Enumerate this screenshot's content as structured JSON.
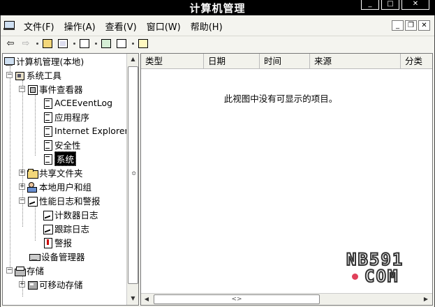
{
  "window": {
    "title": "计算机管理",
    "controls": {
      "minimize": "_",
      "maximize": "□",
      "close": "✕"
    }
  },
  "menubar": {
    "items": [
      "文件(F)",
      "操作(A)",
      "查看(V)",
      "窗口(W)",
      "帮助(H)"
    ],
    "mdi_controls": {
      "minimize": "_",
      "restore": "❐",
      "close": "✕"
    }
  },
  "toolbar": {
    "buttons": [
      "back-icon",
      "forward-icon",
      "up-folder-icon",
      "show-hide-tree-icon",
      "properties-icon",
      "refresh-icon",
      "export-list-icon",
      "help-icon"
    ]
  },
  "tree": {
    "items": [
      {
        "label": "计算机管理(本地)",
        "icon": "computer-icon",
        "expander": ""
      },
      {
        "label": "系统工具",
        "icon": "system-tools-icon",
        "expander": "−"
      },
      {
        "label": "事件查看器",
        "icon": "event-viewer-icon",
        "expander": "−"
      },
      {
        "label": "ACEEventLog",
        "icon": "log-icon",
        "expander": ""
      },
      {
        "label": "应用程序",
        "icon": "log-icon",
        "expander": ""
      },
      {
        "label": "Internet Explorer",
        "icon": "log-icon",
        "expander": ""
      },
      {
        "label": "安全性",
        "icon": "log-icon",
        "expander": ""
      },
      {
        "label": "系统",
        "icon": "log-icon",
        "expander": "",
        "selected": true
      },
      {
        "label": "共享文件夹",
        "icon": "shared-folder-icon",
        "expander": "+"
      },
      {
        "label": "本地用户和组",
        "icon": "users-icon",
        "expander": "+"
      },
      {
        "label": "性能日志和警报",
        "icon": "performance-icon",
        "expander": "−"
      },
      {
        "label": "计数器日志",
        "icon": "counter-log-icon",
        "expander": ""
      },
      {
        "label": "跟踪日志",
        "icon": "trace-log-icon",
        "expander": ""
      },
      {
        "label": "警报",
        "icon": "alert-icon",
        "expander": ""
      },
      {
        "label": "设备管理器",
        "icon": "device-manager-icon",
        "expander": ""
      },
      {
        "label": "存储",
        "icon": "storage-icon",
        "expander": "−"
      },
      {
        "label": "可移动存储",
        "icon": "removable-storage-icon",
        "expander": "+"
      }
    ]
  },
  "list": {
    "columns": [
      "类型",
      "日期",
      "时间",
      "来源",
      "分类"
    ],
    "empty_message": "此视图中没有可显示的项目。"
  },
  "scroll": {
    "v_up": "▲",
    "v_down": "▼",
    "v_grip": "≎",
    "h_left": "◀",
    "h_right": "▶",
    "h_grip": "<>"
  },
  "watermark": {
    "line1": "NB591",
    "line2": "COM"
  }
}
